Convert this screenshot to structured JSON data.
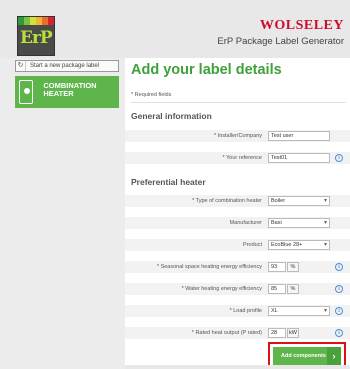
{
  "header": {
    "logo_text": "ErP",
    "logo_colors": [
      "#2e9b3a",
      "#7cc242",
      "#d6e03a",
      "#f4b233",
      "#e8702a",
      "#d7262b"
    ],
    "brand": "WOLSELEY",
    "app_title": "ErP Package Label Generator"
  },
  "sidebar": {
    "new_label": "Start a new package label",
    "refresh_icon": "↻",
    "item_label": "COMBINATION HEATER"
  },
  "main": {
    "title": "Add your label details",
    "required_note": "Required fields",
    "required_star": "*",
    "sections": {
      "general": "General information",
      "heater": "Preferential heater"
    },
    "fields": {
      "installer": {
        "label": "Installer/Company",
        "value": "Test user"
      },
      "reference": {
        "label": "Your reference",
        "value": "Test01"
      },
      "combination_type": {
        "label": "Type of combination heater",
        "value": "Boiler"
      },
      "manufacturer": {
        "label": "Manufacturer",
        "value": "Baxi"
      },
      "product": {
        "label": "Product",
        "value": "EcoBlue 28+"
      },
      "space_heating": {
        "label": "Seasonal space heating energy efficiency",
        "value": "93",
        "unit": "%"
      },
      "water_heating": {
        "label": "Water heating energy efficiency",
        "value": "85",
        "unit": "%"
      },
      "load_profile": {
        "label": "Load profile",
        "value": "XL"
      },
      "heat_output": {
        "label": "Rated heat output (P rated)",
        "value": "28",
        "unit": "kW"
      }
    },
    "info_glyph": "i",
    "add_button": "Add components",
    "add_arrow": "›"
  }
}
